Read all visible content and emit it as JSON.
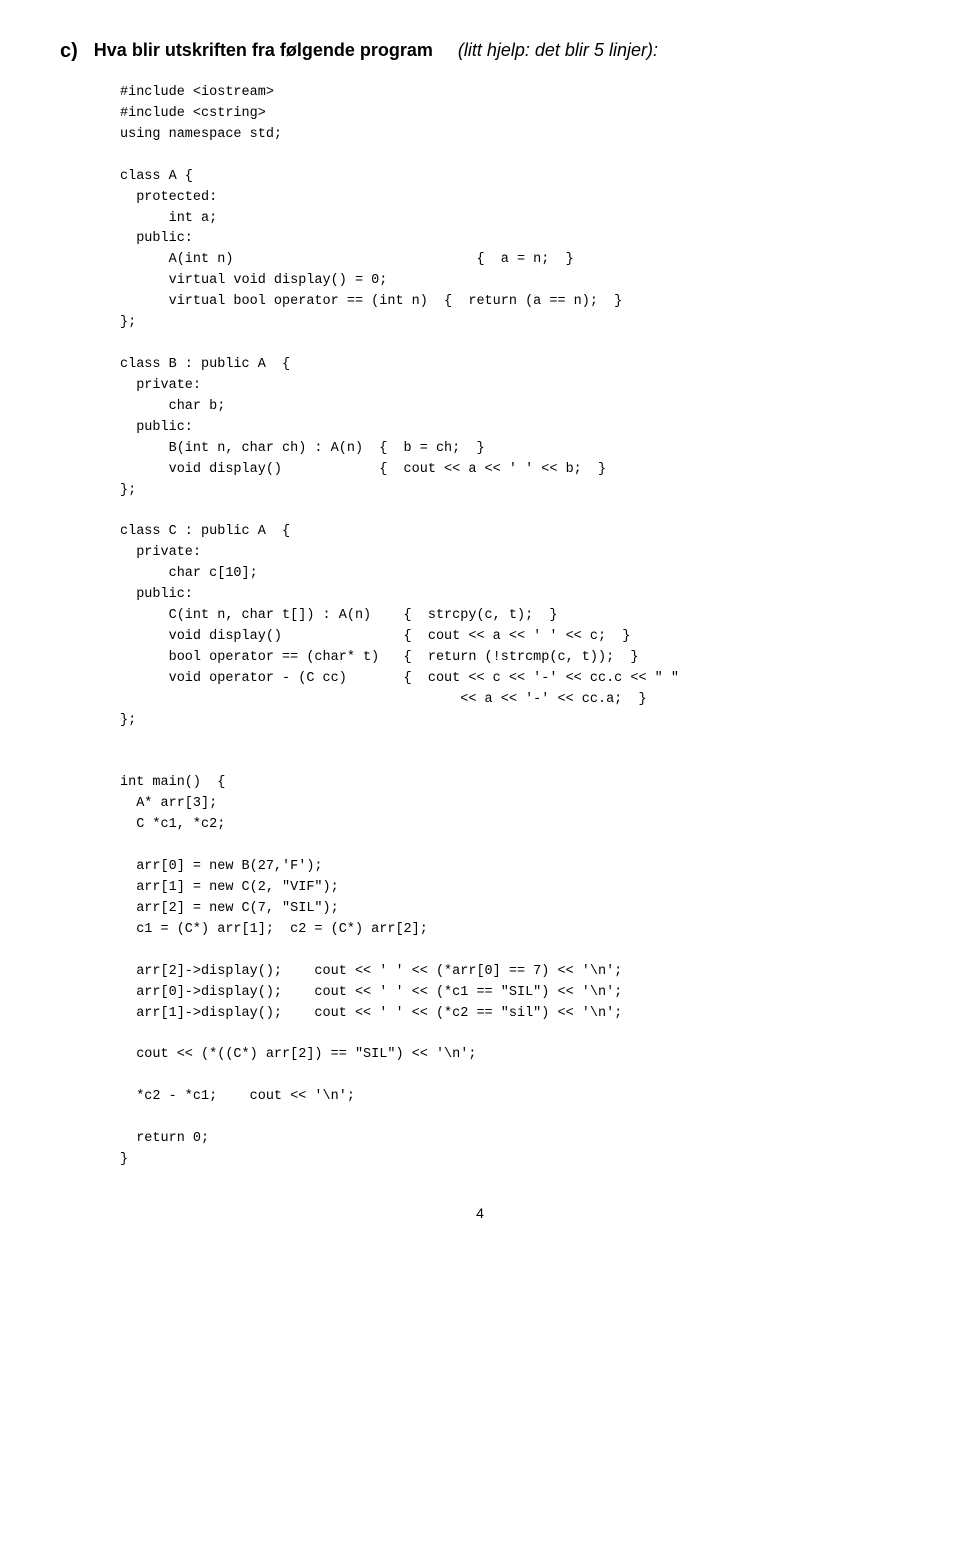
{
  "question": {
    "label": "c)",
    "title": "Hva blir utskriften fra følgende program",
    "hint": "(litt hjelp: det blir 5 linjer):"
  },
  "code": "#include <iostream>\n#include <cstring>\nusing namespace std;\n\nclass A {\n  protected:\n      int a;\n  public:\n      A(int n)                              {  a = n;  }\n      virtual void display() = 0;\n      virtual bool operator == (int n)  {  return (a == n);  }\n};\n\nclass B : public A  {\n  private:\n      char b;\n  public:\n      B(int n, char ch) : A(n)  {  b = ch;  }\n      void display()            {  cout << a << ' ' << b;  }\n};\n\nclass C : public A  {\n  private:\n      char c[10];\n  public:\n      C(int n, char t[]) : A(n)    {  strcpy(c, t);  }\n      void display()               {  cout << a << ' ' << c;  }\n      bool operator == (char* t)   {  return (!strcmp(c, t));  }\n      void operator - (C cc)       {  cout << c << '-' << cc.c << \" \"\n                                          << a << '-' << cc.a;  }\n};\n\n\nint main()  {\n  A* arr[3];\n  C *c1, *c2;\n\n  arr[0] = new B(27,'F');\n  arr[1] = new C(2, \"VIF\");\n  arr[2] = new C(7, \"SIL\");\n  c1 = (C*) arr[1];  c2 = (C*) arr[2];\n\n  arr[2]->display();    cout << ' ' << (*arr[0] == 7) << '\\n';\n  arr[0]->display();    cout << ' ' << (*c1 == \"SIL\") << '\\n';\n  arr[1]->display();    cout << ' ' << (*c2 == \"sil\") << '\\n';\n\n  cout << (*((C*) arr[2]) == \"SIL\") << '\\n';\n\n  *c2 - *c1;    cout << '\\n';\n\n  return 0;\n}",
  "page_number": "4"
}
